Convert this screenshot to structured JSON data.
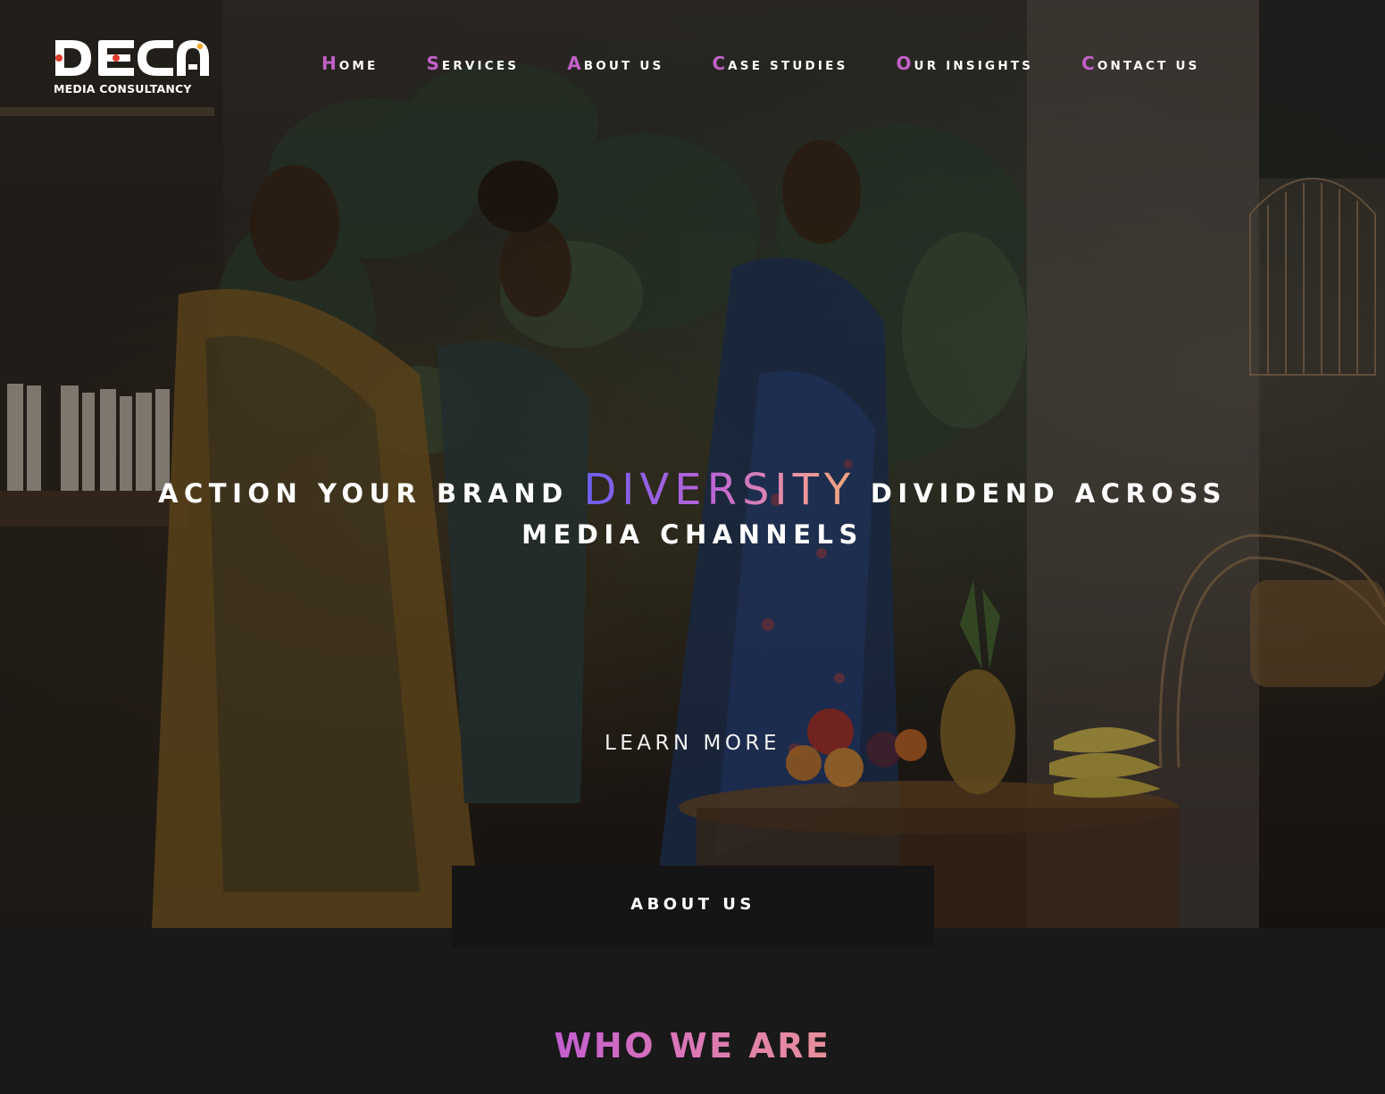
{
  "brand": {
    "logo_text": "DECA",
    "logo_subtitle": "MEDIA CONSULTANCY"
  },
  "nav": {
    "items": [
      {
        "first": "H",
        "rest": "ome"
      },
      {
        "first": "S",
        "rest": "ervices"
      },
      {
        "first": "A",
        "rest": "bout us"
      },
      {
        "first": "C",
        "rest": "ase studies"
      },
      {
        "first": "O",
        "rest": "ur insights"
      },
      {
        "first": "C",
        "rest": "ontact us"
      }
    ]
  },
  "hero": {
    "headline_before": "ACTION YOUR BRAND",
    "headline_accent": "DIVERSITY",
    "headline_after": "DIVIDEND ACROSS",
    "headline_line2": "MEDIA CHANNELS",
    "cta": "LEARN MORE"
  },
  "about_tab": {
    "label": "ABOUT US"
  },
  "section": {
    "title": "WHO WE ARE"
  },
  "colors": {
    "accent_purple": "#c260c8",
    "background_dark": "#1a191a",
    "tab_dark": "#161516",
    "gradient_start": "#6c5ff0",
    "gradient_end": "#f2a67a"
  }
}
